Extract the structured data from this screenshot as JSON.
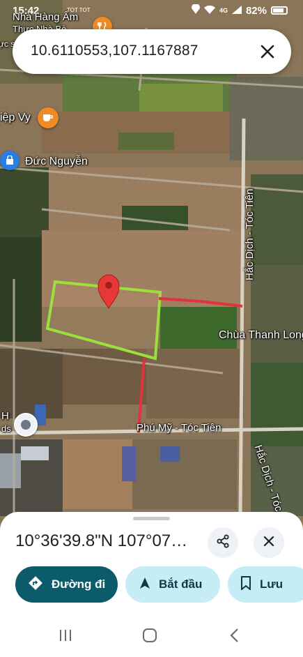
{
  "status_bar": {
    "time": "15:42",
    "mini_text": "TOT TOT",
    "network": "4G",
    "battery": "82%"
  },
  "search": {
    "query": "10.6110553,107.1167887"
  },
  "map_labels": {
    "restaurant_top": "Nhà Hàng Ẩm",
    "restaurant_top_line2": "Thực Nhà Bè",
    "top_left_clip": "ực sĩ",
    "cafe": "iệp Vy",
    "shop": "Đức Nguyễn",
    "road_vertical_top": "Hắc Dịch - Tóc Tiên",
    "pagoda": "Chùa Thanh Long",
    "road_horizontal": "Phú Mỹ - Tóc Tiên",
    "road_vertical_bottom": "Hắc Dịch - Tóc",
    "left_poi_line1": "H",
    "left_poi_line2": "ds"
  },
  "bottom_sheet": {
    "coordinates": "10°36'39.8\"N 107°07…",
    "actions": {
      "directions": "Đường đi",
      "start": "Bắt đầu",
      "save": "Lưu"
    }
  },
  "colors": {
    "primary_button": "#0b5b6b",
    "secondary_button": "#c6ecf5",
    "plot_outline": "#9be03c",
    "route_line": "#e0333d",
    "pin": "#e53935"
  },
  "icons": {
    "close": "close-icon",
    "share": "share-icon",
    "directions": "directions-icon",
    "navigate": "navigation-arrow-icon",
    "save": "bookmark-icon",
    "restaurant": "restaurant-icon",
    "cafe": "coffee-icon",
    "shop": "shopping-bag-icon",
    "pin": "location-pin-icon"
  }
}
